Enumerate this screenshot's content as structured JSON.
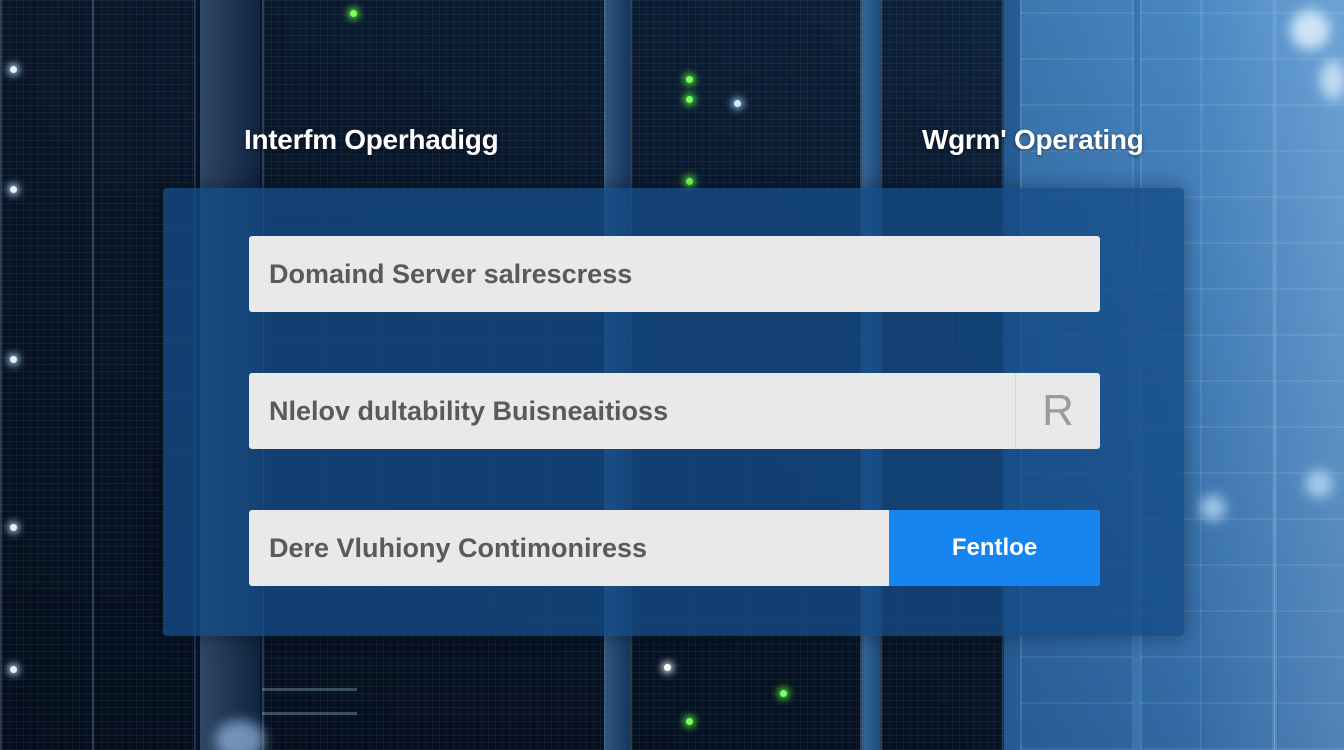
{
  "headings": {
    "left": "Interfm  Operhadigg",
    "right": "Wgrm' Operating"
  },
  "form": {
    "field_1": {
      "value": "Domaind Server salrescress"
    },
    "field_2": {
      "value": "Nlelov dultability Buisneaitioss",
      "side_label": "R"
    },
    "field_3": {
      "value": "Dere Vluhiony Contimoniress",
      "button_label": "Fentloe"
    }
  },
  "colors": {
    "panel": "#144b87",
    "field_background": "#e9e9e9",
    "field_text": "#5a5a5a",
    "button": "#1685f0",
    "led_green": "#5dff3a",
    "led_blue": "#9fd4ff"
  },
  "background": {
    "scene": "server-racks",
    "icon": "server-rack-icon"
  }
}
